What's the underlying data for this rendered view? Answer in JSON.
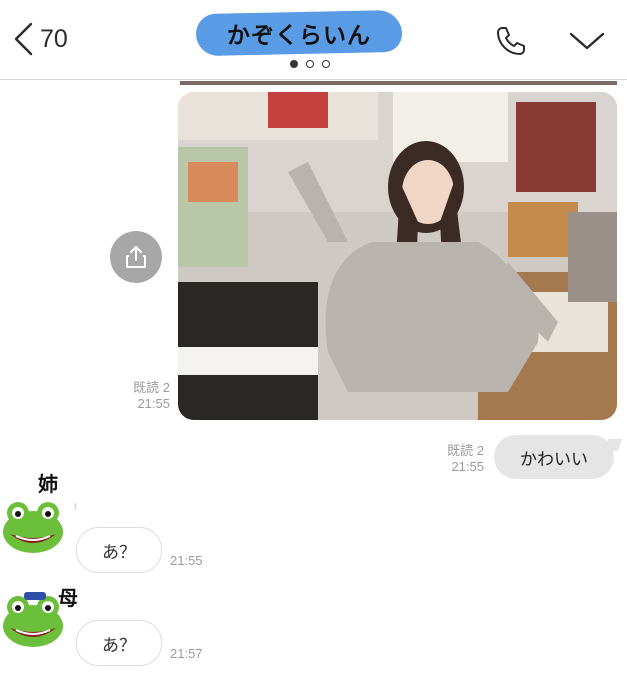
{
  "header": {
    "back_count": "70",
    "chat_title": "かぞくらいん",
    "page_dots": [
      true,
      false,
      false
    ]
  },
  "messages": {
    "photo_meta": {
      "read": "既読 2",
      "time": "21:55"
    },
    "outgoing_text": {
      "text": "かわいい",
      "read": "既読 2",
      "time": "21:55"
    },
    "incoming": [
      {
        "sender_tag": "姉",
        "sender_name": "l",
        "text": "あ？",
        "time": "21:55"
      },
      {
        "sender_tag": "母",
        "text": "あ？",
        "time": "21:57"
      }
    ]
  },
  "colors": {
    "title_highlight": "#5a9be6",
    "bubble_out": "#e5e5e5",
    "share_button": "#a7a7a7"
  },
  "icons": [
    "back-chevron-icon",
    "phone-icon",
    "chevron-down-icon",
    "share-icon",
    "frog-avatar"
  ]
}
